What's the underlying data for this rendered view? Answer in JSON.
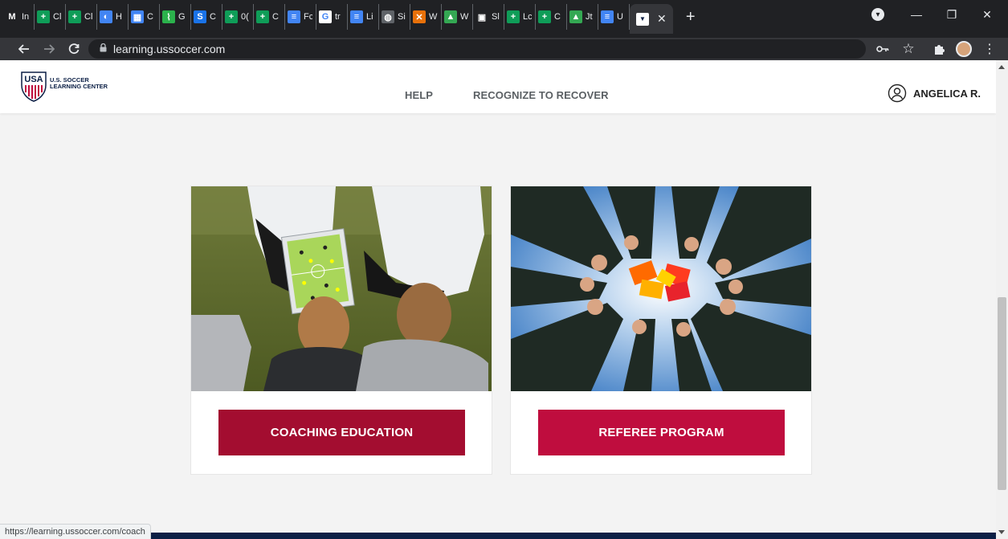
{
  "browser": {
    "tabs": [
      {
        "icon": "gmail-icon",
        "title": "In",
        "color": "#202124",
        "glyph": "M"
      },
      {
        "icon": "sheets-icon",
        "title": "Cl",
        "color": "#0f9d58",
        "glyph": "+"
      },
      {
        "icon": "sheets-icon",
        "title": "Cl",
        "color": "#0f9d58",
        "glyph": "+"
      },
      {
        "icon": "color-wheel-icon",
        "title": "H",
        "color": "#4285f4",
        "glyph": "◐"
      },
      {
        "icon": "calendar-icon",
        "title": "C",
        "color": "#4285f4",
        "glyph": "▦"
      },
      {
        "icon": "feedly-icon",
        "title": "G",
        "color": "#2bb24c",
        "glyph": "⌇"
      },
      {
        "icon": "swirl-icon",
        "title": "C",
        "color": "#1a73e8",
        "glyph": "S"
      },
      {
        "icon": "sheets-icon",
        "title": "0(",
        "color": "#0f9d58",
        "glyph": "+"
      },
      {
        "icon": "sheets-icon",
        "title": "C",
        "color": "#0f9d58",
        "glyph": "+"
      },
      {
        "icon": "docs-icon",
        "title": "Fc",
        "color": "#4285f4",
        "glyph": "≡"
      },
      {
        "icon": "google-icon",
        "title": "tr",
        "color": "#ffffff",
        "glyph": "G"
      },
      {
        "icon": "docs-icon",
        "title": "Li",
        "color": "#4285f4",
        "glyph": "≡"
      },
      {
        "icon": "globe-icon",
        "title": "Si",
        "color": "#5f6368",
        "glyph": "◍"
      },
      {
        "icon": "bird-icon",
        "title": "W",
        "color": "#e8710a",
        "glyph": "✕"
      },
      {
        "icon": "cube-icon",
        "title": "W",
        "color": "#34a853",
        "glyph": "▲"
      },
      {
        "icon": "box-icon",
        "title": "Sl",
        "color": "#202124",
        "glyph": "▣"
      },
      {
        "icon": "sheets-icon",
        "title": "Lc",
        "color": "#0f9d58",
        "glyph": "+"
      },
      {
        "icon": "sheets-icon",
        "title": "C",
        "color": "#0f9d58",
        "glyph": "+"
      },
      {
        "icon": "cube-icon",
        "title": "Jt",
        "color": "#34a853",
        "glyph": "▲"
      },
      {
        "icon": "docs-icon",
        "title": "U",
        "color": "#4285f4",
        "glyph": "≡"
      }
    ],
    "active_tab": {
      "icon": "ussoccer-favicon-icon",
      "close": "✕"
    },
    "new_tab": "+",
    "address": "learning.ussoccer.com",
    "window_controls": {
      "menu": "▾",
      "minimize": "—",
      "restore": "❐",
      "close": "✕"
    },
    "status_url": "https://learning.ussoccer.com/coach"
  },
  "site": {
    "logo_line1": "U.S. SOCCER",
    "logo_line2": "LEARNING CENTER",
    "logo_mark": "USA",
    "nav": {
      "help": "HELP",
      "recognize": "RECOGNIZE TO RECOVER"
    },
    "user_name": "ANGELICA R."
  },
  "cards": [
    {
      "name": "coaching",
      "button": "COACHING EDUCATION",
      "button_color": "#a30d30"
    },
    {
      "name": "referee",
      "button": "REFEREE PROGRAM",
      "button_color": "#bf0d3e"
    }
  ],
  "colors": {
    "footer": "#0b1f45",
    "chrome_dark": "#202124"
  }
}
